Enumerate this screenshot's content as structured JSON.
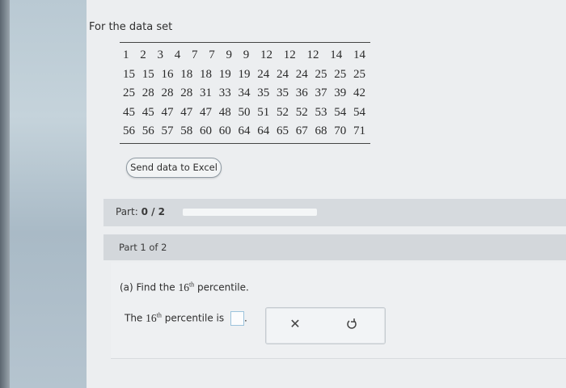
{
  "intro": "For the data set",
  "data_rows": [
    [
      "1",
      "2",
      "3",
      "4",
      "7",
      "7",
      "9",
      "9",
      "12",
      "12",
      "12",
      "14",
      "14"
    ],
    [
      "15",
      "15",
      "16",
      "18",
      "18",
      "19",
      "19",
      "24",
      "24",
      "24",
      "25",
      "25",
      "25"
    ],
    [
      "25",
      "28",
      "28",
      "28",
      "31",
      "33",
      "34",
      "35",
      "35",
      "36",
      "37",
      "39",
      "42"
    ],
    [
      "45",
      "45",
      "47",
      "47",
      "47",
      "48",
      "50",
      "51",
      "52",
      "52",
      "53",
      "54",
      "54"
    ],
    [
      "56",
      "56",
      "57",
      "58",
      "60",
      "60",
      "64",
      "64",
      "65",
      "67",
      "68",
      "70",
      "71"
    ]
  ],
  "excel_button": "Send data to Excel",
  "part": {
    "label": "Part:",
    "value": "0 / 2",
    "progress": 0
  },
  "step_label": "Part 1 of 2",
  "question": {
    "prefix": "(a) Find the",
    "number": "16",
    "ordinal": "th",
    "suffix": "percentile."
  },
  "answer": {
    "prefix": "The",
    "number": "16",
    "ordinal": "th",
    "suffix": "percentile is",
    "punct": "."
  },
  "icons": {
    "clear": "x-icon",
    "undo": "undo-icon"
  },
  "colors": {
    "accent": "#7bb3d6",
    "input_border": "#9cc3dc"
  }
}
